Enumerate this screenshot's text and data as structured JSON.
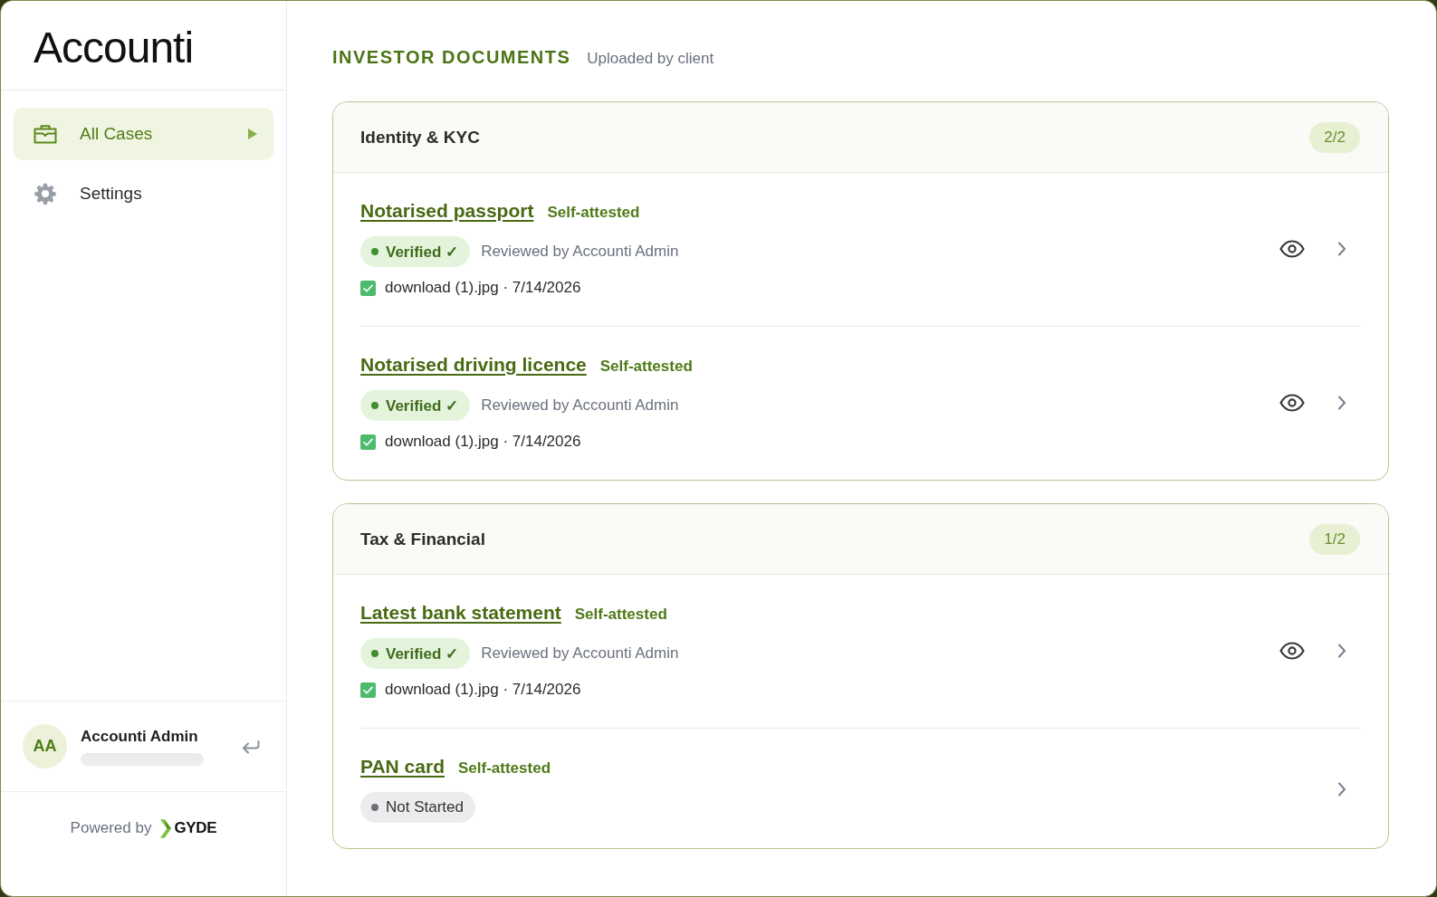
{
  "sidebar": {
    "logo": "Accounti",
    "nav": [
      {
        "label": "All Cases",
        "selected": true
      },
      {
        "label": "Settings",
        "selected": false
      }
    ],
    "user": {
      "initials": "AA",
      "name": "Accounti Admin"
    },
    "footer": {
      "prefix": "Powered by",
      "brand": "GYDE"
    }
  },
  "main": {
    "title": "INVESTOR DOCUMENTS",
    "subtitle": "Uploaded by client",
    "sections": [
      {
        "title": "Identity & KYC",
        "count": "2/2",
        "documents": [
          {
            "name": "Notarised passport",
            "attestation": "Self-attested",
            "status": {
              "kind": "verified",
              "label": "Verified ✓"
            },
            "reviewed_by": "Reviewed by Accounti Admin",
            "file": {
              "checked": true,
              "label": "download (1).jpg · 7/14/2026"
            },
            "previewable": true
          },
          {
            "name": "Notarised driving licence",
            "attestation": "Self-attested",
            "status": {
              "kind": "verified",
              "label": "Verified ✓"
            },
            "reviewed_by": "Reviewed by Accounti Admin",
            "file": {
              "checked": true,
              "label": "download (1).jpg · 7/14/2026"
            },
            "previewable": true
          }
        ]
      },
      {
        "title": "Tax & Financial",
        "count": "1/2",
        "documents": [
          {
            "name": "Latest bank statement",
            "attestation": "Self-attested",
            "status": {
              "kind": "verified",
              "label": "Verified ✓"
            },
            "reviewed_by": "Reviewed by Accounti Admin",
            "file": {
              "checked": true,
              "label": "download (1).jpg · 7/14/2026"
            },
            "previewable": true
          },
          {
            "name": "PAN card",
            "attestation": "Self-attested",
            "status": {
              "kind": "not_started",
              "label": "Not Started"
            },
            "previewable": false
          }
        ]
      }
    ]
  }
}
